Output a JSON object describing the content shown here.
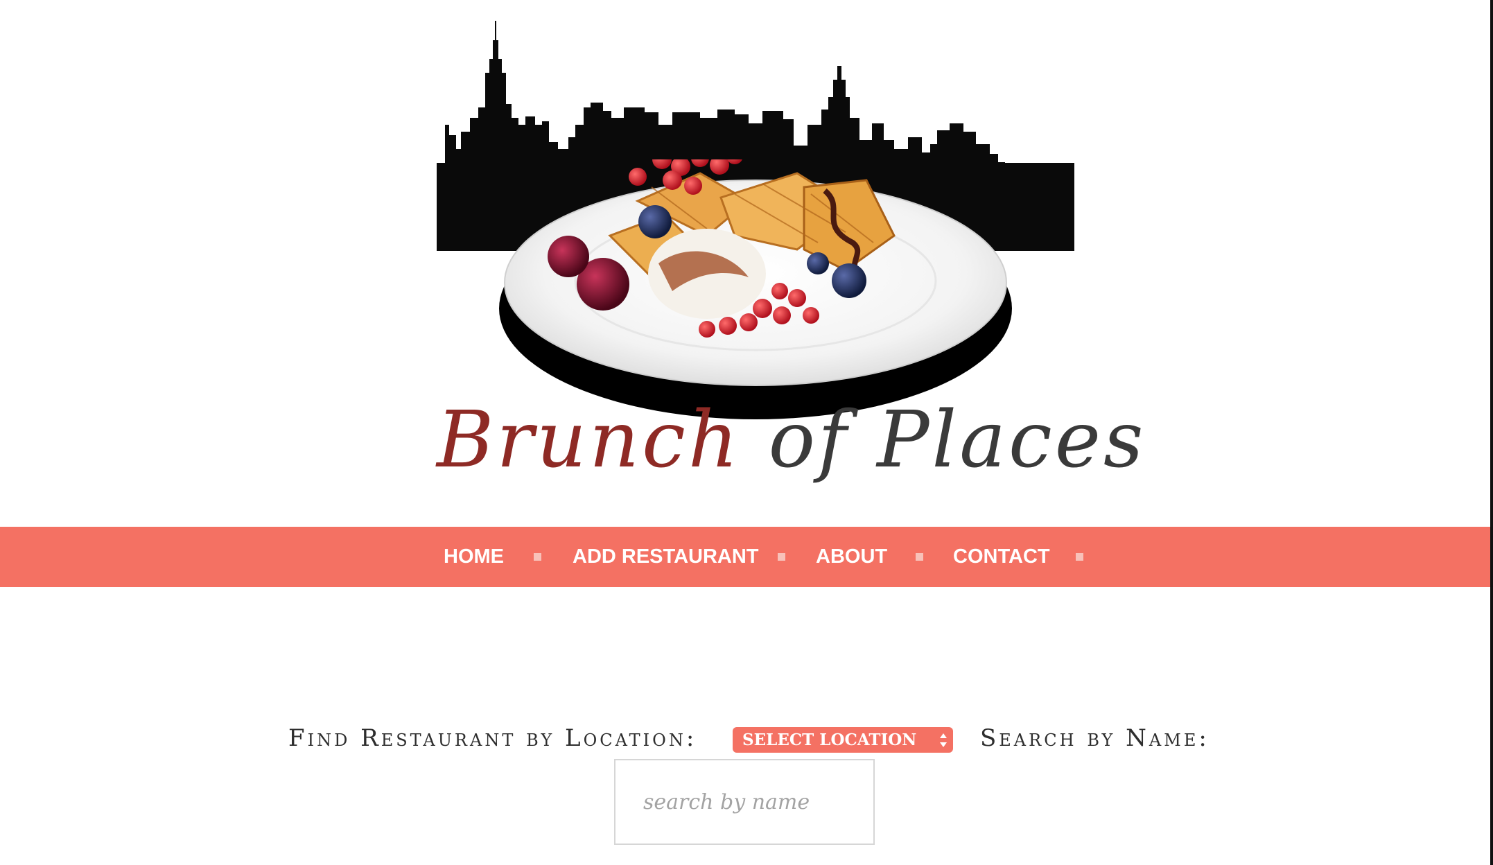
{
  "brand": {
    "word1": "Brunch",
    "word2": "of Places",
    "colors": {
      "brunch": "#8e2a25",
      "places": "#3a3a3a"
    }
  },
  "nav": {
    "accent": "#f47163",
    "items": [
      {
        "label": "HOME"
      },
      {
        "label": "ADD RESTAURANT"
      },
      {
        "label": "ABOUT"
      },
      {
        "label": "CONTACT"
      }
    ]
  },
  "search": {
    "location_label": "Find Restaurant by Location:",
    "location_select": "SELECT LOCATION",
    "name_label": "Search by Name:",
    "name_placeholder": "search by name",
    "name_value": ""
  }
}
